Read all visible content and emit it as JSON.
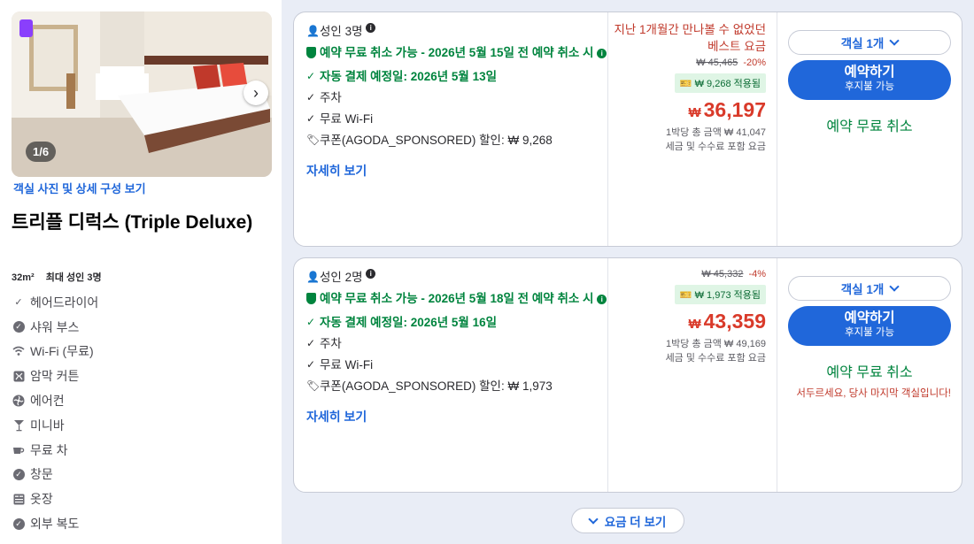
{
  "room": {
    "photo_counter": "1/6",
    "photo_link": "객실 사진 및 상세 구성 보기",
    "title": "트리플 디럭스 (Triple Deluxe)",
    "size": "32m²",
    "max_guests": "최대 성인 3명",
    "amenities": [
      {
        "icon": "check-icon",
        "label": "헤어드라이어"
      },
      {
        "icon": "check-circle-icon",
        "label": "샤워 부스"
      },
      {
        "icon": "wifi-icon",
        "label": "Wi-Fi (무료)"
      },
      {
        "icon": "blackout-curtain-icon",
        "label": "암막 커튼"
      },
      {
        "icon": "fan-icon",
        "label": "에어컨"
      },
      {
        "icon": "cocktail-icon",
        "label": "미니바"
      },
      {
        "icon": "cup-icon",
        "label": "무료 차"
      },
      {
        "icon": "check-circle-icon",
        "label": "창문"
      },
      {
        "icon": "wardrobe-icon",
        "label": "옷장"
      },
      {
        "icon": "check-circle-icon",
        "label": "외부 복도"
      }
    ]
  },
  "offers": [
    {
      "guests": "성인 3명",
      "cancel_policy": "예약 무료 취소 가능 - 2026년 5월 15일 전 예약 취소 시",
      "payment_date": "자동 결제 예정일: 2026년 5월 13일",
      "parking": "주차",
      "wifi": "무료 Wi-Fi",
      "coupon": "쿠폰(AGODA_SPONSORED) 할인: ₩ 9,268",
      "details_link": "자세히 보기",
      "promo": "지난 1개월간 만나볼 수 없었던 베스트 요금",
      "original_price": "₩ 45,465",
      "discount": "-20%",
      "coupon_applied": "₩ 9,268 적용됨",
      "currency": "₩",
      "price": "36,197",
      "total_per_night": "1박당 총 금액 ₩ 41,047",
      "tax_note": "세금 및 수수료 포함 요금",
      "rooms_select": "객실 1개",
      "book_label": "예약하기",
      "book_sub": "후지불 가능",
      "free_cancel": "예약 무료 취소",
      "urgency": ""
    },
    {
      "guests": "성인 2명",
      "cancel_policy": "예약 무료 취소 가능 - 2026년 5월 18일 전 예약 취소 시",
      "payment_date": "자동 결제 예정일: 2026년 5월 16일",
      "parking": "주차",
      "wifi": "무료 Wi-Fi",
      "coupon": "쿠폰(AGODA_SPONSORED) 할인: ₩ 1,973",
      "details_link": "자세히 보기",
      "promo": "",
      "original_price": "₩ 45,332",
      "discount": "-4%",
      "coupon_applied": "₩ 1,973 적용됨",
      "currency": "₩",
      "price": "43,359",
      "total_per_night": "1박당 총 금액 ₩ 49,169",
      "tax_note": "세금 및 수수료 포함 요금",
      "rooms_select": "객실 1개",
      "book_label": "예약하기",
      "book_sub": "후지불 가능",
      "free_cancel": "예약 무료 취소",
      "urgency": "서두르세요, 당사 마지막 객실입니다!"
    }
  ],
  "more_rates": "요금 더 보기",
  "colors": {
    "accent": "#2067da",
    "green": "#00843e",
    "price_red": "#d93a2a",
    "badge_purple": "#8a3ffc"
  }
}
